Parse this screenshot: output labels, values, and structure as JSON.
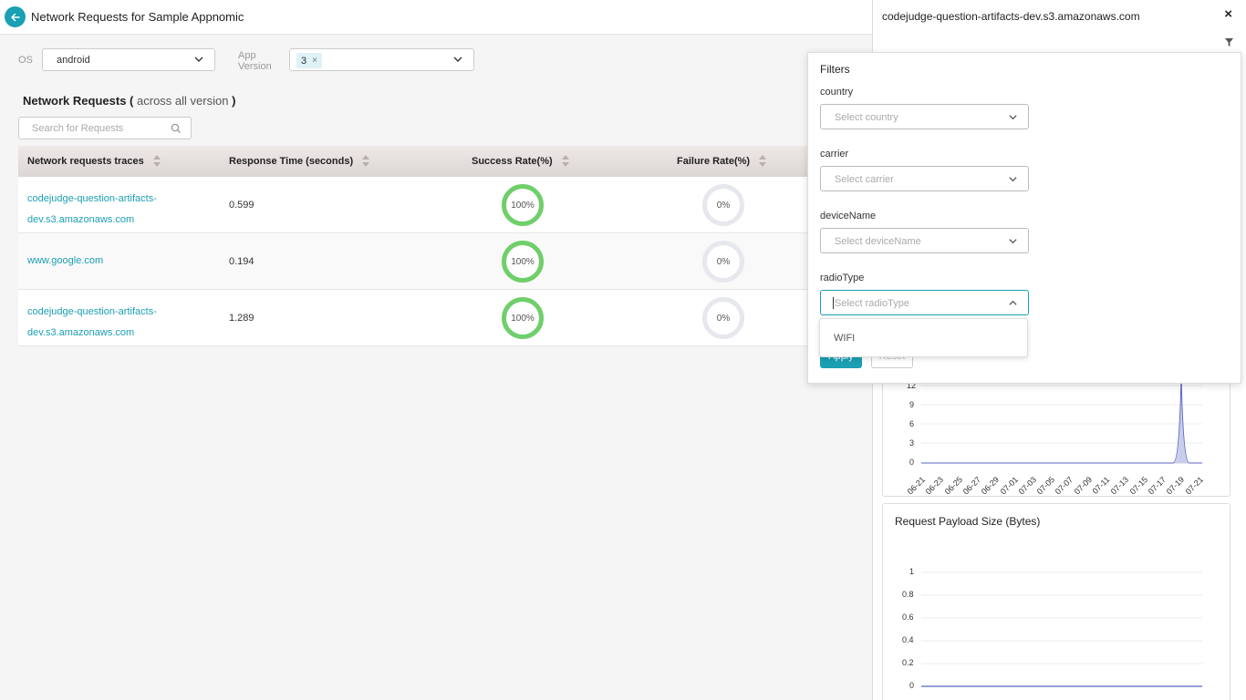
{
  "header": {
    "title": "Network Requests for Sample Appnomic"
  },
  "filters": {
    "os_label": "OS",
    "os_value": "android",
    "app_version_label_1": "App",
    "app_version_label_2": "Version",
    "app_version_tag": "3",
    "app_version_tag_remove": "×"
  },
  "section": {
    "title": "Network Requests",
    "paren_open": "(",
    "sub": "across all version",
    "paren_close": ")"
  },
  "search": {
    "placeholder": "Search for Requests"
  },
  "table": {
    "columns": [
      "Network requests traces",
      "Response Time (seconds)",
      "Success Rate(%)",
      "Failure Rate(%)"
    ],
    "rows": [
      {
        "trace_line1": "codejudge-question-artifacts-",
        "trace_line2": "dev.s3.amazonaws.com",
        "response": "0.599",
        "success": "100%",
        "failure": "0%"
      },
      {
        "trace_line1": "www.google.com",
        "trace_line2": "",
        "response": "0.194",
        "success": "100%",
        "failure": "0%"
      },
      {
        "trace_line1": "codejudge-question-artifacts-",
        "trace_line2": "dev.s3.amazonaws.com",
        "response": "1.289",
        "success": "100%",
        "failure": "0%"
      }
    ]
  },
  "detail": {
    "title": "codejudge-question-artifacts-dev.s3.amazonaws.com",
    "close": "×",
    "chart1_y_ticks": [
      "12",
      "9",
      "6",
      "3",
      "0"
    ],
    "chart1_x_ticks": [
      "06-21",
      "06-23",
      "06-25",
      "06-27",
      "06-29",
      "07-01",
      "07-03",
      "07-05",
      "07-07",
      "07-09",
      "07-11",
      "07-13",
      "07-15",
      "07-17",
      "07-19",
      "07-21"
    ],
    "chart2_title": "Request Payload Size (Bytes)",
    "chart2_y_ticks": [
      "1",
      "0.8",
      "0.6",
      "0.4",
      "0.2",
      "0"
    ]
  },
  "popup": {
    "title": "Filters",
    "fields": [
      {
        "label": "country",
        "placeholder": "Select country"
      },
      {
        "label": "carrier",
        "placeholder": "Select carrier"
      },
      {
        "label": "deviceName",
        "placeholder": "Select deviceName"
      },
      {
        "label": "radioType",
        "placeholder": "Select radioType"
      }
    ],
    "apply": "Apply",
    "reset": "Reset",
    "dropdown_options": [
      "WIFI"
    ]
  }
}
